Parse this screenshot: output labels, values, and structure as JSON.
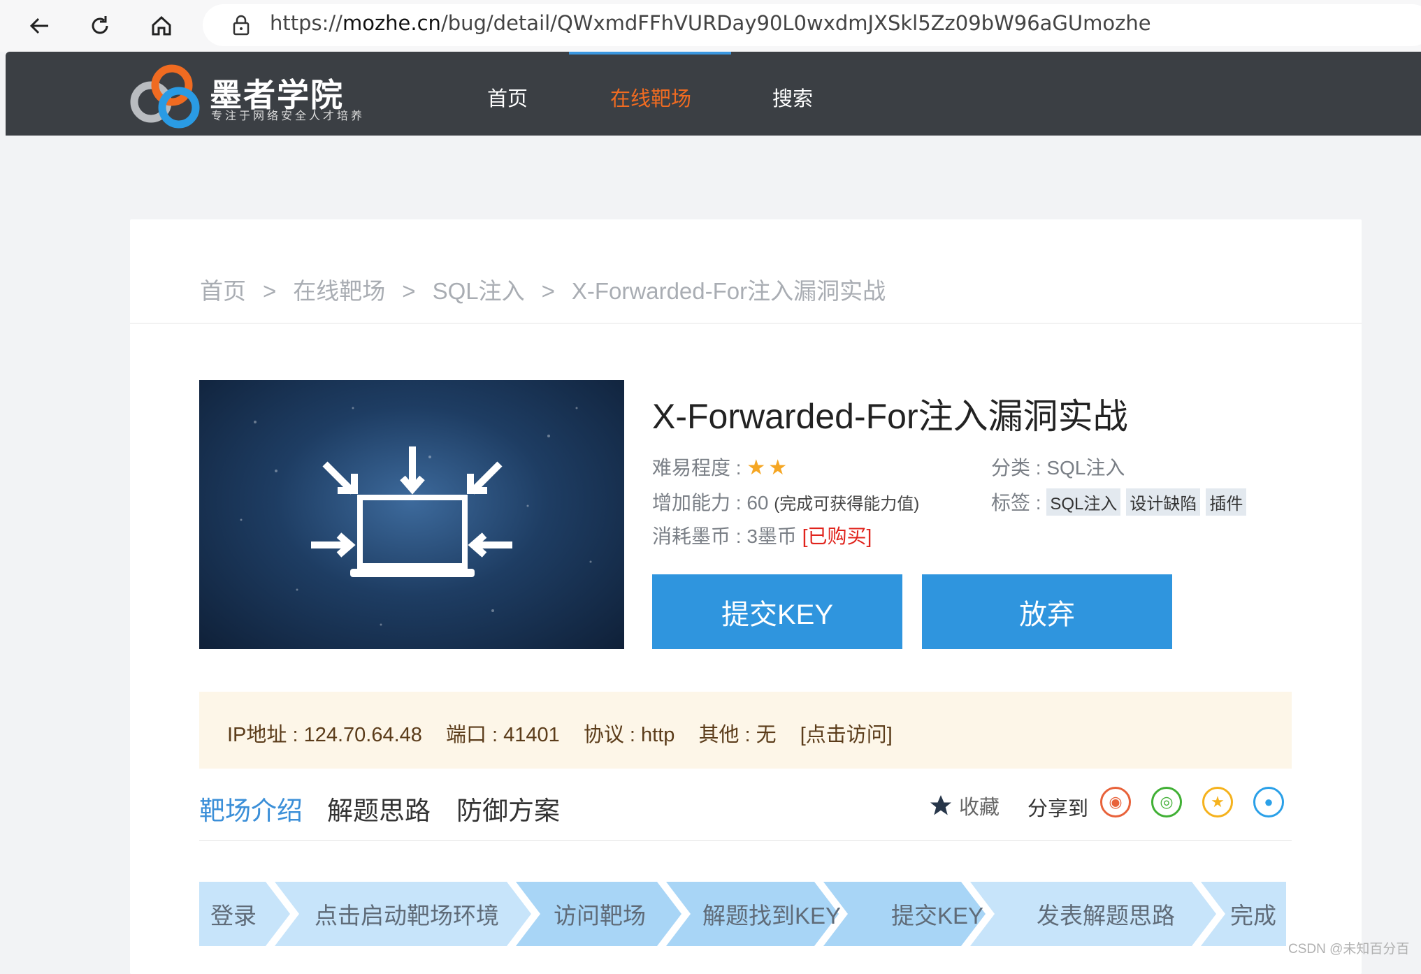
{
  "browser": {
    "url_prefix": "https://",
    "url_domain": "mozhe.cn",
    "url_path": "/bug/detail/QWxmdFFhVURDay90L0wxdmJXSkl5Zz09bW96aGUmozhe"
  },
  "site": {
    "logo_title": "墨者学院",
    "logo_subtitle": "专注于网络安全人才培养",
    "nav": [
      "首页",
      "在线靶场",
      "搜索"
    ]
  },
  "breadcrumb": {
    "items": [
      "首页",
      "在线靶场",
      "SQL注入",
      "X-Forwarded-For注入漏洞实战"
    ],
    "separator": ">"
  },
  "lab": {
    "title": "X-Forwarded-For注入漏洞实战",
    "difficulty_label": "难易程度 :",
    "difficulty_stars": "★★",
    "category_label": "分类 :",
    "category_value": "SQL注入",
    "ability_label": "增加能力 :",
    "ability_value": "60",
    "ability_note": "(完成可获得能力值)",
    "tags_label": "标签 :",
    "tags": [
      "SQL注入",
      "设计缺陷",
      "插件"
    ],
    "cost_label": "消耗墨币 :",
    "cost_value": "3墨币",
    "cost_status": "[已购买]",
    "submit_btn": "提交KEY",
    "abandon_btn": "放弃"
  },
  "target": {
    "ip": "IP地址 : 124.70.64.48",
    "port": "端口 : 41401",
    "protocol": "协议 : http",
    "other": "其他 : 无",
    "visit": "[点击访问]"
  },
  "tabs": [
    "靶场介绍",
    "解题思路",
    "防御方案"
  ],
  "actions": {
    "favorite": "收藏",
    "share": "分享到"
  },
  "steps": [
    "登录",
    "点击启动靶场环境",
    "访问靶场",
    "解题找到KEY",
    "提交KEY",
    "发表解题思路",
    "完成"
  ],
  "watermark": "CSDN @未知百分百",
  "colors": {
    "accent": "#2f95de",
    "nav_active": "#f06b21",
    "header_bg": "#3b3f44",
    "info_bg": "#fdf6e8"
  }
}
